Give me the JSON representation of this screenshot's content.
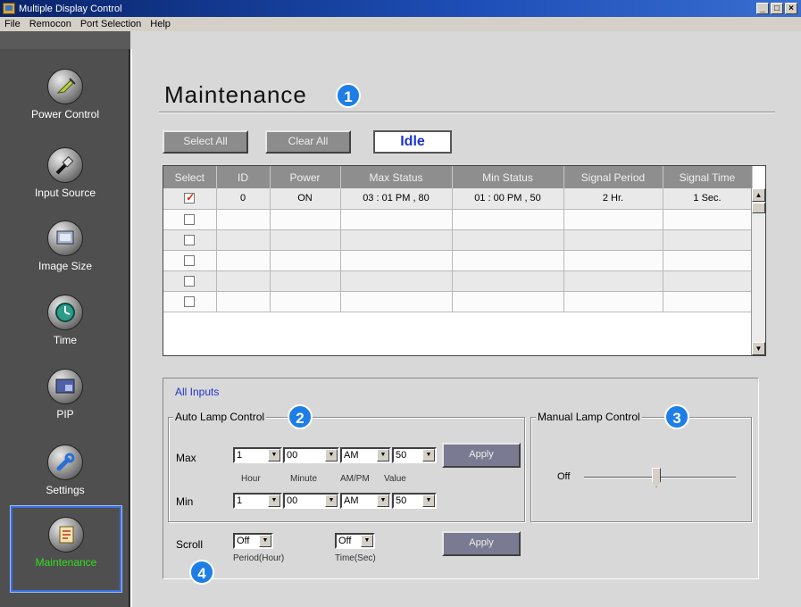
{
  "window": {
    "title": "Multiple Display Control"
  },
  "menu": [
    "File",
    "Remocon",
    "Port Selection",
    "Help"
  ],
  "sidebar": {
    "items": [
      {
        "label": "Power Control",
        "icon": "power-plug-icon"
      },
      {
        "label": "Input Source",
        "icon": "cable-connector-icon"
      },
      {
        "label": "Image Size",
        "icon": "screen-size-icon"
      },
      {
        "label": "Time",
        "icon": "clock-icon"
      },
      {
        "label": "PIP",
        "icon": "pip-icon"
      },
      {
        "label": "Settings",
        "icon": "wrench-icon"
      },
      {
        "label": "Maintenance",
        "icon": "notepad-icon",
        "selected": true
      }
    ]
  },
  "main": {
    "title": "Maintenance",
    "select_all": "Select All",
    "clear_all": "Clear All",
    "status": "Idle",
    "table": {
      "columns": [
        "Select",
        "ID",
        "Power",
        "Max Status",
        "Min Status",
        "Signal Period",
        "Signal Time"
      ],
      "rows": [
        {
          "checked": true,
          "id": "0",
          "power": "ON",
          "max_status": "03 : 01  PM , 80",
          "min_status": "01 : 00  PM , 50",
          "signal_period": "2 Hr.",
          "signal_time": "1 Sec."
        },
        {
          "checked": false,
          "id": "",
          "power": "",
          "max_status": "",
          "min_status": "",
          "signal_period": "",
          "signal_time": ""
        },
        {
          "checked": false,
          "id": "",
          "power": "",
          "max_status": "",
          "min_status": "",
          "signal_period": "",
          "signal_time": ""
        },
        {
          "checked": false,
          "id": "",
          "power": "",
          "max_status": "",
          "min_status": "",
          "signal_period": "",
          "signal_time": ""
        },
        {
          "checked": false,
          "id": "",
          "power": "",
          "max_status": "",
          "min_status": "",
          "signal_period": "",
          "signal_time": ""
        },
        {
          "checked": false,
          "id": "",
          "power": "",
          "max_status": "",
          "min_status": "",
          "signal_period": "",
          "signal_time": ""
        }
      ]
    },
    "all_inputs": "All Inputs",
    "auto_lamp": {
      "label": "Auto Lamp Control",
      "max_label": "Max",
      "min_label": "Min",
      "max": {
        "hour": "1",
        "minute": "00",
        "ampm": "AM",
        "value": "50"
      },
      "min": {
        "hour": "1",
        "minute": "00",
        "ampm": "AM",
        "value": "50"
      },
      "sublabels": {
        "hour": "Hour",
        "minute": "Minute",
        "ampm": "AM/PM",
        "value": "Value"
      },
      "apply": "Apply"
    },
    "manual_lamp": {
      "label": "Manual Lamp Control",
      "off_label": "Off",
      "level": 0.55
    },
    "scroll": {
      "label": "Scroll",
      "period": "Off",
      "time": "Off",
      "period_label": "Period(Hour)",
      "time_label": "Time(Sec)",
      "apply": "Apply"
    },
    "badges": [
      "1",
      "2",
      "3",
      "4"
    ]
  }
}
